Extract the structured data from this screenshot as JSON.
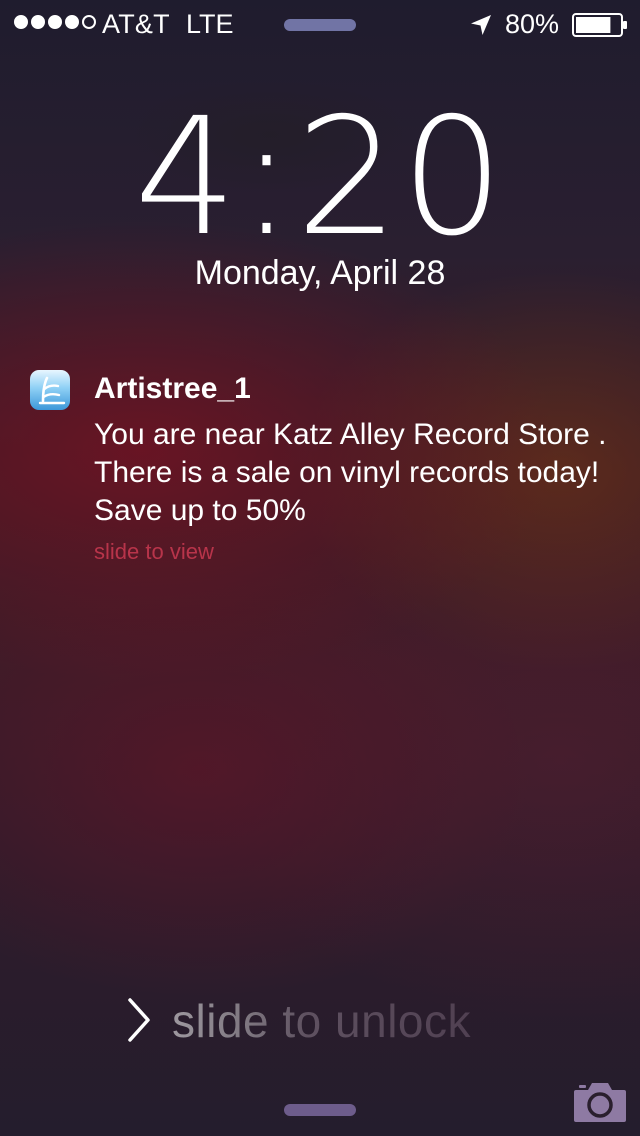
{
  "status_bar": {
    "signal_bars_filled": 4,
    "signal_bars_total": 5,
    "carrier": "AT&T",
    "network": "LTE",
    "location_icon": "location-arrow-icon",
    "battery_percent": "80%",
    "battery_level": 0.8
  },
  "lock_screen": {
    "time": "4:20",
    "date": "Monday, April 28"
  },
  "notification": {
    "app_icon": "artistree-app-icon",
    "title": "Artistree_1",
    "body": "You are near Katz Alley Record Store . There is a sale on vinyl records today! Save up to 50%",
    "action": "slide to view"
  },
  "unlock": {
    "label": "slide to unlock",
    "chevron_icon": "chevron-right-icon"
  },
  "camera": {
    "icon": "camera-icon"
  },
  "colors": {
    "notification_action": "#b8344a",
    "grabber": "#8c91cd"
  }
}
